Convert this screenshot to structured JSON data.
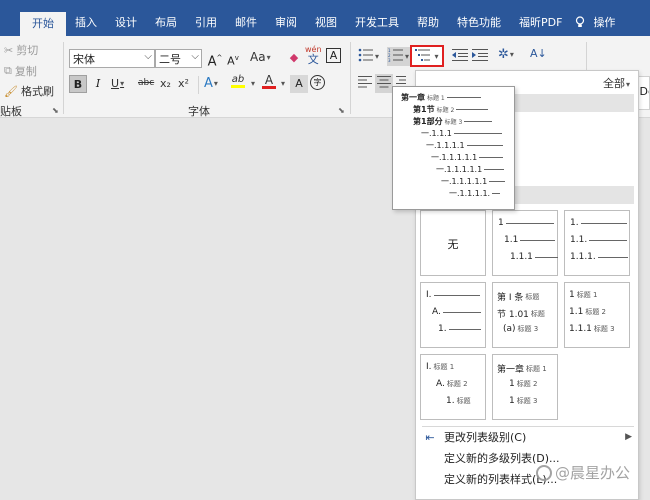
{
  "tabs": [
    "开始",
    "插入",
    "设计",
    "布局",
    "引用",
    "邮件",
    "审阅",
    "视图",
    "开发工具",
    "帮助",
    "特色功能",
    "福昕PDF",
    "操作"
  ],
  "clipboard": {
    "cut": "剪切",
    "copy": "复制",
    "format_painter": "格式刷",
    "group_label": "贴板"
  },
  "font": {
    "name": "宋体",
    "size": "二号",
    "group_label": "字体",
    "grow": "A",
    "shrink": "A",
    "case": "Aa",
    "phonetic": "wén",
    "bold": "B",
    "italic": "I",
    "underline": "U",
    "strike": "abc",
    "sub": "x₂",
    "sup": "x²",
    "text_effect": "A",
    "highlight": "ab",
    "font_color": "A",
    "circle_char": "字"
  },
  "styles": {
    "sample": "AaBbCcDd"
  },
  "gallery": {
    "filter": "全部",
    "none_label": "无",
    "thumb2": [
      "1",
      "1.1",
      "1.1.1"
    ],
    "thumb3": [
      "1.",
      "1.1.",
      "1.1.1."
    ],
    "thumb4": [
      "I.",
      "A.",
      "1."
    ],
    "thumb5": [
      {
        "text": "第 I 条",
        "tag": "标题"
      },
      {
        "text": "节 1.01",
        "tag": "标题"
      },
      {
        "text": "(a)",
        "tag": "标题 3"
      }
    ],
    "thumb6": [
      {
        "text": "1",
        "tag": "标题 1"
      },
      {
        "text": "1.1",
        "tag": "标题 2"
      },
      {
        "text": "1.1.1",
        "tag": "标题 3"
      }
    ],
    "thumb7": [
      {
        "text": "I.",
        "tag": "标题 1"
      },
      {
        "text": "A.",
        "tag": "标题 2"
      },
      {
        "text": "1.",
        "tag": "标题"
      }
    ],
    "thumb8": [
      {
        "text": "第一章",
        "tag": "标题 1"
      },
      {
        "text": "1",
        "tag": "标题 2"
      },
      {
        "text": "1",
        "tag": "标题 3"
      }
    ],
    "menu": {
      "change_level": "更改列表级别(C)",
      "define_multilevel": "定义新的多级列表(D)...",
      "define_style": "定义新的列表样式(L)..."
    }
  },
  "preview": [
    {
      "text": "第一章",
      "tag": "标题 1"
    },
    {
      "text": "第1节",
      "tag": "标题 2"
    },
    {
      "text": "第1部分",
      "tag": "标题 3"
    },
    {
      "text": "一.1.1.1",
      "tag": ""
    },
    {
      "text": "一.1.1.1.1",
      "tag": ""
    },
    {
      "text": "一.1.1.1.1.1",
      "tag": ""
    },
    {
      "text": "一.1.1.1.1.1",
      "tag": ""
    },
    {
      "text": "一.1.1.1.1.1",
      "tag": ""
    },
    {
      "text": "一.1.1.1.1.",
      "tag": ""
    }
  ],
  "watermark": "@晨星办公"
}
